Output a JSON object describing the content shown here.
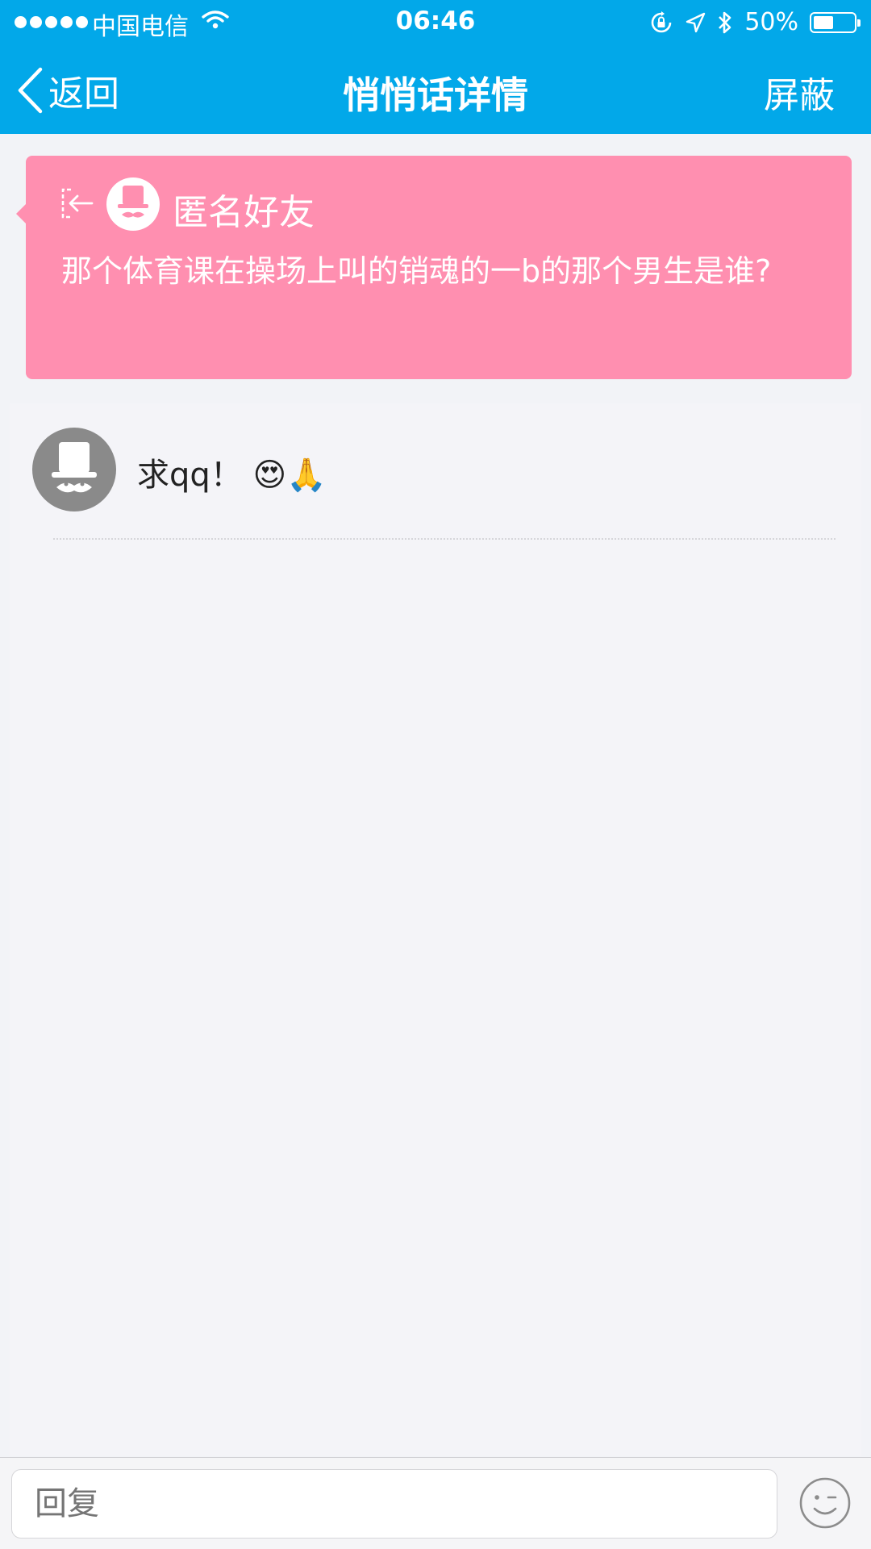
{
  "status_bar": {
    "carrier": "中国电信",
    "time": "06:46",
    "battery_percent": "50%",
    "battery_level": 0.5,
    "icons": [
      "signal-dots-icon",
      "wifi-icon",
      "rotation-lock-icon",
      "location-icon",
      "bluetooth-icon",
      "battery-icon"
    ]
  },
  "nav": {
    "back_label": "返回",
    "title": "悄悄话详情",
    "right_label": "屏蔽"
  },
  "whisper": {
    "author": "匿名好友",
    "text": "那个体育课在操场上叫的销魂的一b的那个男生是谁?",
    "background_color": "#ff8fb0"
  },
  "comments": [
    {
      "text": "求qq！ 😍🙏"
    }
  ],
  "reply": {
    "placeholder": "回复"
  },
  "colors": {
    "header": "#02a8e9",
    "page_background": "#f2f3f7"
  }
}
